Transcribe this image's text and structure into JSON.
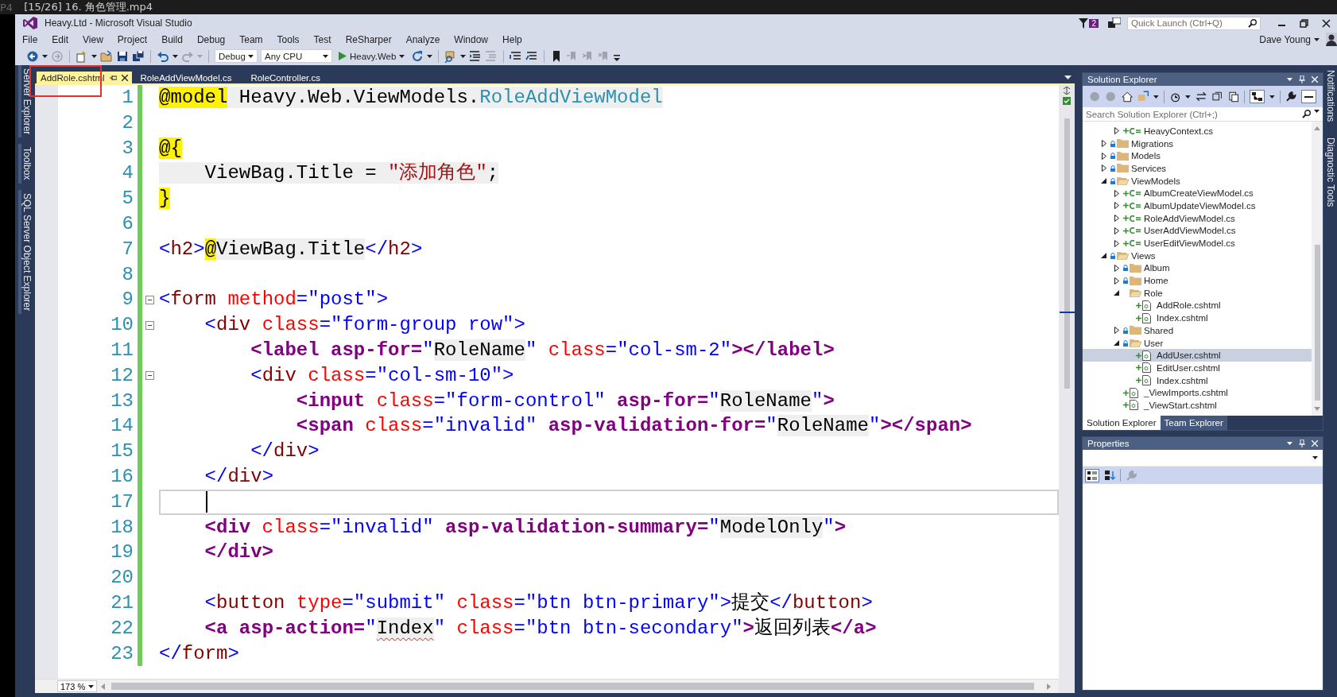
{
  "player": {
    "format": "P4",
    "title": "[15/26] 16. 角色管理.mp4"
  },
  "window": {
    "title": "Heavy.Ltd - Microsoft Visual Studio",
    "notification_count": "2",
    "quick_launch": {
      "placeholder": "Quick Launch (Ctrl+Q)"
    },
    "user": "Dave Young"
  },
  "menu": [
    "File",
    "Edit",
    "View",
    "Project",
    "Build",
    "Debug",
    "Team",
    "Tools",
    "Test",
    "ReSharper",
    "Analyze",
    "Window",
    "Help"
  ],
  "toolbar": {
    "configuration": "Debug",
    "platform": "Any CPU",
    "start": "Heavy.Web"
  },
  "tabs": [
    {
      "label": "AddRole.cshtml",
      "selected": true,
      "annotated": true
    },
    {
      "label": "RoleAddViewModel.cs",
      "selected": false,
      "annotated": false
    },
    {
      "label": "RoleController.cs",
      "selected": false,
      "annotated": false
    }
  ],
  "left_panels": [
    "Server Explorer",
    "Toolbox",
    "SQL Server Object Explorer"
  ],
  "editor": {
    "zoom": "173 %",
    "lines": [
      {
        "number": "1",
        "fold": false,
        "current": false,
        "tokens": [
          {
            "kind": "razor",
            "text": "@model"
          },
          {
            "kind": "csharp",
            "text": " Heavy.Web.ViewModels."
          },
          {
            "kind": "type",
            "text": "RoleAddViewModel"
          }
        ]
      },
      {
        "number": "2",
        "fold": false,
        "current": false
      },
      {
        "number": "3",
        "fold": false,
        "current": false,
        "tokens": [
          {
            "kind": "razor",
            "text": "@{"
          }
        ]
      },
      {
        "number": "4",
        "fold": false,
        "current": false,
        "tokens": [
          {
            "kind": "csharp",
            "text": "    ViewBag.Title = "
          },
          {
            "kind": "string",
            "text": "\"添加角色\""
          },
          {
            "kind": "csharp",
            "text": ";"
          }
        ]
      },
      {
        "number": "5",
        "fold": false,
        "current": false,
        "tokens": [
          {
            "kind": "razor",
            "text": "}"
          }
        ]
      },
      {
        "number": "6",
        "fold": false,
        "current": false
      },
      {
        "number": "7",
        "fold": false,
        "current": false,
        "tokens": [
          {
            "kind": "delim",
            "text": "<"
          },
          {
            "kind": "tag",
            "text": "h2"
          },
          {
            "kind": "delim",
            "text": ">"
          },
          {
            "kind": "razor",
            "text": "@"
          },
          {
            "kind": "csharp",
            "text": "ViewBag.Title"
          },
          {
            "kind": "delim",
            "text": "</"
          },
          {
            "kind": "tag",
            "text": "h2"
          },
          {
            "kind": "delim",
            "text": ">"
          }
        ]
      },
      {
        "number": "8",
        "fold": false,
        "current": false
      },
      {
        "number": "9",
        "fold": true,
        "current": false,
        "tokens": [
          {
            "kind": "delim",
            "text": "<"
          },
          {
            "kind": "tag",
            "text": "form"
          },
          {
            "kind": "attr",
            "text": " method"
          },
          {
            "kind": "delim",
            "text": "="
          },
          {
            "kind": "value",
            "text": "\"post\""
          },
          {
            "kind": "delim",
            "text": ">"
          }
        ]
      },
      {
        "number": "10",
        "fold": true,
        "current": false,
        "tokens": [
          {
            "kind": "delim",
            "text": "    <"
          },
          {
            "kind": "tag",
            "text": "div"
          },
          {
            "kind": "attr",
            "text": " class"
          },
          {
            "kind": "delim",
            "text": "="
          },
          {
            "kind": "value",
            "text": "\"form-group row\""
          },
          {
            "kind": "delim",
            "text": ">"
          }
        ]
      },
      {
        "number": "11",
        "fold": false,
        "current": false,
        "tokens": [
          {
            "kind": "helper",
            "text": "        <label"
          },
          {
            "kind": "helper",
            "text": " asp-for="
          },
          {
            "kind": "value",
            "text": "\""
          },
          {
            "kind": "expr",
            "text": "RoleName"
          },
          {
            "kind": "value",
            "text": "\""
          },
          {
            "kind": "attr",
            "text": " class"
          },
          {
            "kind": "delim",
            "text": "="
          },
          {
            "kind": "value",
            "text": "\"col-sm-2\""
          },
          {
            "kind": "helper",
            "text": "></label>"
          }
        ]
      },
      {
        "number": "12",
        "fold": true,
        "current": false,
        "tokens": [
          {
            "kind": "delim",
            "text": "        <"
          },
          {
            "kind": "tag",
            "text": "div"
          },
          {
            "kind": "attr",
            "text": " class"
          },
          {
            "kind": "delim",
            "text": "="
          },
          {
            "kind": "value",
            "text": "\"col-sm-10\""
          },
          {
            "kind": "delim",
            "text": ">"
          }
        ]
      },
      {
        "number": "13",
        "fold": false,
        "current": false,
        "tokens": [
          {
            "kind": "helper",
            "text": "            <input"
          },
          {
            "kind": "attr",
            "text": " class"
          },
          {
            "kind": "delim",
            "text": "="
          },
          {
            "kind": "value",
            "text": "\"form-control\""
          },
          {
            "kind": "helper",
            "text": " asp-for="
          },
          {
            "kind": "value",
            "text": "\""
          },
          {
            "kind": "expr",
            "text": "RoleName"
          },
          {
            "kind": "value",
            "text": "\""
          },
          {
            "kind": "helper",
            "text": ">"
          }
        ]
      },
      {
        "number": "14",
        "fold": false,
        "current": false,
        "tokens": [
          {
            "kind": "helper",
            "text": "            <span"
          },
          {
            "kind": "attr",
            "text": " class"
          },
          {
            "kind": "delim",
            "text": "="
          },
          {
            "kind": "value",
            "text": "\"invalid\""
          },
          {
            "kind": "helper",
            "text": " asp-validation-for="
          },
          {
            "kind": "value",
            "text": "\""
          },
          {
            "kind": "expr",
            "text": "RoleName"
          },
          {
            "kind": "value",
            "text": "\""
          },
          {
            "kind": "helper",
            "text": "></span>"
          }
        ]
      },
      {
        "number": "15",
        "fold": false,
        "current": false,
        "tokens": [
          {
            "kind": "delim",
            "text": "        </"
          },
          {
            "kind": "tag",
            "text": "div"
          },
          {
            "kind": "delim",
            "text": ">"
          }
        ]
      },
      {
        "number": "16",
        "fold": false,
        "current": false,
        "tokens": [
          {
            "kind": "delim",
            "text": "    </"
          },
          {
            "kind": "tag",
            "text": "div"
          },
          {
            "kind": "delim",
            "text": ">"
          }
        ]
      },
      {
        "number": "17",
        "fold": false,
        "current": true
      },
      {
        "number": "18",
        "fold": false,
        "current": false,
        "tokens": [
          {
            "kind": "helper",
            "text": "    <div"
          },
          {
            "kind": "attr",
            "text": " class"
          },
          {
            "kind": "delim",
            "text": "="
          },
          {
            "kind": "value",
            "text": "\"invalid\""
          },
          {
            "kind": "helper",
            "text": " asp-validation-summary="
          },
          {
            "kind": "value",
            "text": "\""
          },
          {
            "kind": "expr",
            "text": "ModelOnly"
          },
          {
            "kind": "value",
            "text": "\""
          },
          {
            "kind": "helper",
            "text": ">"
          }
        ]
      },
      {
        "number": "19",
        "fold": false,
        "current": false,
        "tokens": [
          {
            "kind": "helper",
            "text": "    </div>"
          }
        ]
      },
      {
        "number": "20",
        "fold": false,
        "current": false
      },
      {
        "number": "21",
        "fold": false,
        "current": false,
        "tokens": [
          {
            "kind": "delim",
            "text": "    <"
          },
          {
            "kind": "tag",
            "text": "button"
          },
          {
            "kind": "attr",
            "text": " type"
          },
          {
            "kind": "delim",
            "text": "="
          },
          {
            "kind": "value",
            "text": "\"submit\""
          },
          {
            "kind": "attr",
            "text": " class"
          },
          {
            "kind": "delim",
            "text": "="
          },
          {
            "kind": "value",
            "text": "\"btn btn-primary\""
          },
          {
            "kind": "delim",
            "text": ">"
          },
          {
            "kind": "text",
            "text": "提交"
          },
          {
            "kind": "delim",
            "text": "</"
          },
          {
            "kind": "tag",
            "text": "button"
          },
          {
            "kind": "delim",
            "text": ">"
          }
        ]
      },
      {
        "number": "22",
        "fold": false,
        "current": false,
        "tokens": [
          {
            "kind": "helper",
            "text": "    <a"
          },
          {
            "kind": "helper",
            "text": " asp-action="
          },
          {
            "kind": "value",
            "text": "\""
          },
          {
            "kind": "error",
            "text": "Index"
          },
          {
            "kind": "value",
            "text": "\""
          },
          {
            "kind": "attr",
            "text": " class"
          },
          {
            "kind": "delim",
            "text": "="
          },
          {
            "kind": "value",
            "text": "\"btn btn-secondary\""
          },
          {
            "kind": "helper",
            "text": ">"
          },
          {
            "kind": "text",
            "text": "返回列表"
          },
          {
            "kind": "helper",
            "text": "</a>"
          }
        ]
      },
      {
        "number": "23",
        "fold": false,
        "current": false,
        "tokens": [
          {
            "kind": "delim",
            "text": "</"
          },
          {
            "kind": "tag",
            "text": "form"
          },
          {
            "kind": "delim",
            "text": ">"
          }
        ]
      }
    ]
  },
  "solution_explorer": {
    "title": "Solution Explorer",
    "search": {
      "placeholder": "Search Solution Explorer (Ctrl+;)"
    },
    "tree": [
      {
        "children": [
          {
            "label": "HeavyContext.cs",
            "kind": "csharp",
            "expanded": false,
            "selected": false
          }
        ]
      },
      {
        "label": "Migrations",
        "kind": "folder",
        "locked": true,
        "expanded": false,
        "selected": false
      },
      {
        "label": "Models",
        "kind": "folder",
        "locked": true,
        "expanded": false,
        "selected": false
      },
      {
        "label": "Services",
        "kind": "folder",
        "locked": true,
        "expanded": false,
        "selected": false
      },
      {
        "label": "ViewModels",
        "kind": "folder",
        "locked": true,
        "expanded": true,
        "selected": false,
        "children": [
          {
            "label": "AlbumCreateViewModel.cs",
            "kind": "csharp",
            "expanded": false,
            "selected": false
          },
          {
            "label": "AlbumUpdateViewModel.cs",
            "kind": "csharp",
            "expanded": false,
            "selected": false
          },
          {
            "label": "RoleAddViewModel.cs",
            "kind": "csharp",
            "expanded": false,
            "selected": false
          },
          {
            "label": "UserAddViewModel.cs",
            "kind": "csharp",
            "expanded": false,
            "selected": false
          },
          {
            "label": "UserEditViewModel.cs",
            "kind": "csharp",
            "expanded": false,
            "selected": false
          }
        ]
      },
      {
        "label": "Views",
        "kind": "folder",
        "locked": true,
        "expanded": true,
        "selected": false,
        "children": [
          {
            "label": "Album",
            "kind": "folder",
            "locked": true,
            "expanded": false,
            "selected": false
          },
          {
            "label": "Home",
            "kind": "folder",
            "locked": true,
            "expanded": false,
            "selected": false
          },
          {
            "label": "Role",
            "kind": "folder",
            "locked": false,
            "expanded": true,
            "selected": false,
            "children": [
              {
                "label": "AddRole.cshtml",
                "kind": "page",
                "selected": false
              },
              {
                "label": "Index.cshtml",
                "kind": "page",
                "selected": false
              }
            ]
          },
          {
            "label": "Shared",
            "kind": "folder",
            "locked": true,
            "expanded": false,
            "selected": false
          },
          {
            "label": "User",
            "kind": "folder",
            "locked": true,
            "expanded": true,
            "selected": false,
            "children": [
              {
                "label": "AddUser.cshtml",
                "kind": "page",
                "selected": true
              },
              {
                "label": "EditUser.cshtml",
                "kind": "page",
                "selected": false
              },
              {
                "label": "Index.cshtml",
                "kind": "page",
                "selected": false
              }
            ]
          },
          {
            "label": "_ViewImports.cshtml",
            "kind": "page",
            "selected": false
          },
          {
            "label": "_ViewStart.cshtml",
            "kind": "page",
            "selected": false
          }
        ]
      }
    ],
    "tabs": [
      {
        "label": "Solution Explorer",
        "selected": true
      },
      {
        "label": "Team Explorer",
        "selected": false
      }
    ]
  },
  "properties": {
    "title": "Properties"
  },
  "right_panels": [
    "Notifications",
    "Diagnostic Tools"
  ]
}
